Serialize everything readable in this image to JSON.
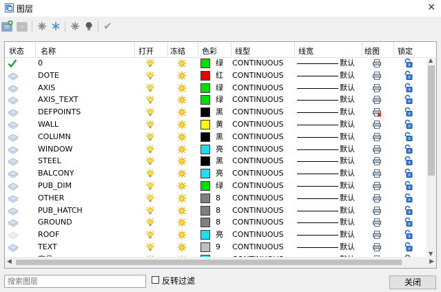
{
  "window": {
    "title": "图层",
    "close_glyph": "✕"
  },
  "toolbar": {
    "buttons": [
      {
        "name": "new-layer-icon"
      },
      {
        "name": "delete-layer-icon"
      },
      {
        "name": "freeze-icon"
      },
      {
        "name": "snowflake-icon"
      },
      {
        "name": "lock-icon"
      },
      {
        "name": "bulb-icon"
      },
      {
        "name": "set-current-icon",
        "glyph": "✔"
      }
    ]
  },
  "columns": [
    "状态",
    "名称",
    "打开",
    "冻结",
    "色彩",
    "线型",
    "线宽",
    "绘图",
    "锁定"
  ],
  "layers": [
    {
      "status": "current",
      "name": "0",
      "color": "#00dd00",
      "color_name": "绿",
      "linetype": "CONTINUOUS",
      "lineweight": "默认",
      "plot": "printer"
    },
    {
      "status": "layer",
      "name": "DOTE",
      "color": "#ee0000",
      "color_name": "红",
      "linetype": "CONTINUOUS",
      "lineweight": "默认",
      "plot": "printer"
    },
    {
      "status": "layer",
      "name": "AXIS",
      "color": "#00dd00",
      "color_name": "绿",
      "linetype": "CONTINUOUS",
      "lineweight": "默认",
      "plot": "printer"
    },
    {
      "status": "layer",
      "name": "AXIS_TEXT",
      "color": "#00dd00",
      "color_name": "绿",
      "linetype": "CONTINUOUS",
      "lineweight": "默认",
      "plot": "printer"
    },
    {
      "status": "layer",
      "name": "DEFPOINTS",
      "color": "#000000",
      "color_name": "黑",
      "linetype": "CONTINUOUS",
      "lineweight": "默认",
      "plot": "no-print"
    },
    {
      "status": "layer",
      "name": "WALL",
      "color": "#ffff00",
      "color_name": "黄",
      "linetype": "CONTINUOUS",
      "lineweight": "默认",
      "plot": "printer"
    },
    {
      "status": "layer",
      "name": "COLUMN",
      "color": "#000000",
      "color_name": "黑",
      "linetype": "CONTINUOUS",
      "lineweight": "默认",
      "plot": "printer"
    },
    {
      "status": "layer",
      "name": "WINDOW",
      "color": "#22ddee",
      "color_name": "亮",
      "linetype": "CONTINUOUS",
      "lineweight": "默认",
      "plot": "printer"
    },
    {
      "status": "layer",
      "name": "STEEL",
      "color": "#000000",
      "color_name": "黑",
      "linetype": "CONTINUOUS",
      "lineweight": "默认",
      "plot": "printer"
    },
    {
      "status": "layer",
      "name": "BALCONY",
      "color": "#22ddee",
      "color_name": "亮",
      "linetype": "CONTINUOUS",
      "lineweight": "默认",
      "plot": "printer"
    },
    {
      "status": "layer",
      "name": "PUB_DIM",
      "color": "#00dd00",
      "color_name": "绿",
      "linetype": "CONTINUOUS",
      "lineweight": "默认",
      "plot": "printer"
    },
    {
      "status": "layer",
      "name": "OTHER",
      "color": "#808080",
      "color_name": "8",
      "linetype": "CONTINUOUS",
      "lineweight": "默认",
      "plot": "printer"
    },
    {
      "status": "layer",
      "name": "PUB_HATCH",
      "color": "#808080",
      "color_name": "8",
      "linetype": "CONTINUOUS",
      "lineweight": "默认",
      "plot": "printer"
    },
    {
      "status": "layer",
      "name": "GROUND",
      "color": "#808080",
      "color_name": "8",
      "linetype": "CONTINUOUS",
      "lineweight": "默认",
      "plot": "printer"
    },
    {
      "status": "layer-dim",
      "name": "ROOF",
      "color": "#22ddee",
      "color_name": "亮",
      "linetype": "CONTINUOUS",
      "lineweight": "默认",
      "plot": "printer"
    },
    {
      "status": "layer",
      "name": "TEXT",
      "color": "#c0c0c0",
      "color_name": "9",
      "linetype": "CONTINUOUS",
      "lineweight": "默认",
      "plot": "printer"
    },
    {
      "status": "layer",
      "name": "家具",
      "color": "#22ddee",
      "color_name": "",
      "linetype": "CONTINUOUS",
      "lineweight": "默认",
      "plot": "printer"
    }
  ],
  "search": {
    "placeholder": "搜索图层",
    "value": ""
  },
  "invert_filter": {
    "label": "反转过滤",
    "checked": false
  },
  "close_button": {
    "label": "关闭"
  }
}
